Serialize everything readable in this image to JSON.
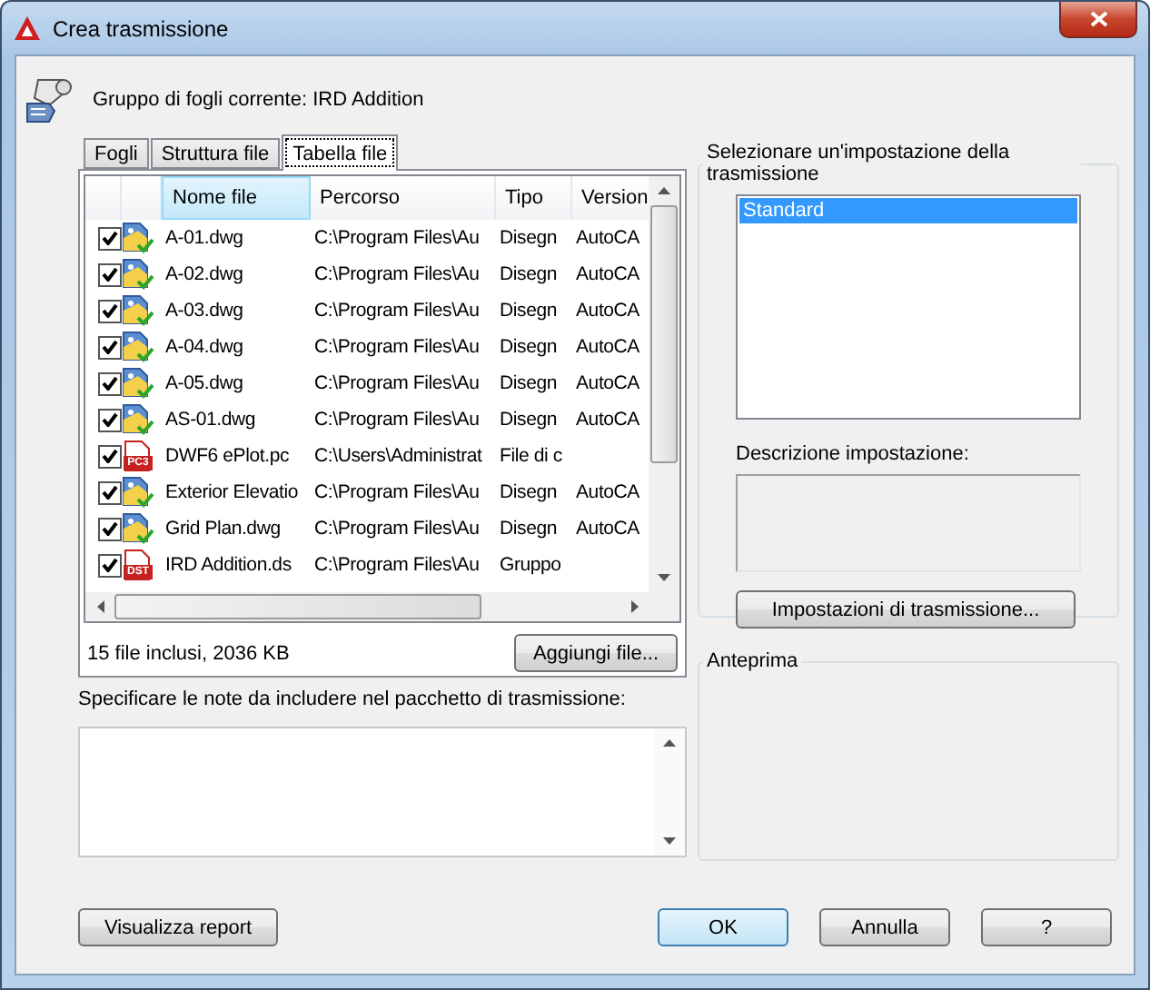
{
  "window": {
    "title": "Crea trasmissione"
  },
  "sheet_set": "Gruppo di fogli corrente: IRD Addition",
  "tabs": [
    {
      "label": "Fogli",
      "selected": false
    },
    {
      "label": "Struttura file",
      "selected": false
    },
    {
      "label": "Tabella file",
      "selected": true
    }
  ],
  "table": {
    "columns": [
      {
        "label": "Nome file",
        "selected": true
      },
      {
        "label": "Percorso",
        "selected": false
      },
      {
        "label": "Tipo",
        "selected": false
      },
      {
        "label": "Version",
        "selected": false
      }
    ],
    "rows": [
      {
        "checked": true,
        "kind": "drawing",
        "name": "A-01.dwg",
        "path": "C:\\Program Files\\Au",
        "type": "Disegn",
        "version": "AutoCA"
      },
      {
        "checked": true,
        "kind": "drawing",
        "name": "A-02.dwg",
        "path": "C:\\Program Files\\Au",
        "type": "Disegn",
        "version": "AutoCA"
      },
      {
        "checked": true,
        "kind": "drawing",
        "name": "A-03.dwg",
        "path": "C:\\Program Files\\Au",
        "type": "Disegn",
        "version": "AutoCA"
      },
      {
        "checked": true,
        "kind": "drawing",
        "name": "A-04.dwg",
        "path": "C:\\Program Files\\Au",
        "type": "Disegn",
        "version": "AutoCA"
      },
      {
        "checked": true,
        "kind": "drawing",
        "name": "A-05.dwg",
        "path": "C:\\Program Files\\Au",
        "type": "Disegn",
        "version": "AutoCA"
      },
      {
        "checked": true,
        "kind": "drawing",
        "name": "AS-01.dwg",
        "path": "C:\\Program Files\\Au",
        "type": "Disegn",
        "version": "AutoCA"
      },
      {
        "checked": true,
        "kind": "tagged",
        "tag": "PC3",
        "name": "DWF6 ePlot.pc",
        "path": "C:\\Users\\Administrat",
        "type": "File di c"
      },
      {
        "checked": true,
        "kind": "drawing",
        "name": "Exterior Elevatio",
        "path": "C:\\Program Files\\Au",
        "type": "Disegn",
        "version": "AutoCA"
      },
      {
        "checked": true,
        "kind": "drawing",
        "name": "Grid Plan.dwg",
        "path": "C:\\Program Files\\Au",
        "type": "Disegn",
        "version": "AutoCA"
      },
      {
        "checked": true,
        "kind": "tagged",
        "tag": "DST",
        "name": "IRD Addition.ds",
        "path": "C:\\Program Files\\Au",
        "type": "Gruppo"
      }
    ]
  },
  "summary": "15 file inclusi, 2036 KB",
  "add_button": "Aggiungi file...",
  "notes": {
    "label": "Specificare le note da includere nel pacchetto di trasmissione:"
  },
  "setup": {
    "legend": "Selezionare un'impostazione della trasmissione",
    "items": [
      {
        "label": "Standard",
        "selected": true
      }
    ],
    "description_label": "Descrizione impostazione:",
    "button": "Impostazioni di trasmissione..."
  },
  "preview": {
    "legend": "Anteprima"
  },
  "buttons": [
    {
      "label": "Visualizza report",
      "default": false
    },
    {
      "label": "OK",
      "default": true
    },
    {
      "label": "Annulla",
      "default": false
    },
    {
      "label": "?",
      "default": false
    }
  ]
}
